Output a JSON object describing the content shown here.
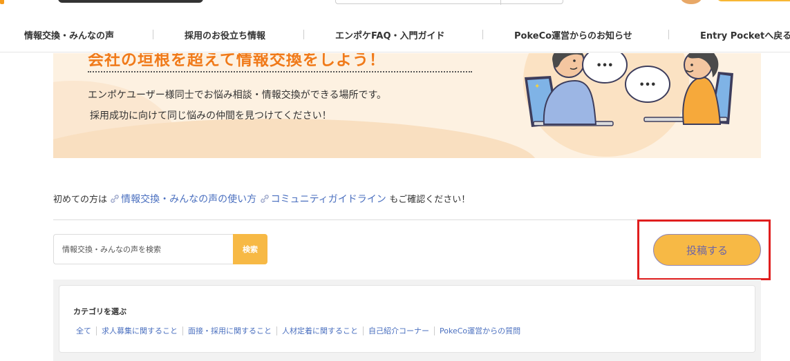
{
  "nav": {
    "items": [
      "情報交換・みんなの声",
      "採用のお役立ち情報",
      "エンポケFAQ・入門ガイド",
      "PokeCo運営からのお知らせ",
      "Entry Pocketへ戻る"
    ]
  },
  "hero": {
    "title": "会社の垣根を超えて情報交換をしよう！",
    "line1": "エンポケユーザー様同士でお悩み相談・情報交換ができる場所です。",
    "line2": "採用成功に向けて同じ悩みの仲間を見つけてください！",
    "bubble_text": "•••"
  },
  "guide": {
    "prefix": "初めての方は",
    "link1": "情報交換・みんなの声の使い方",
    "link2": "コミュニティガイドライン",
    "suffix": "もご確認ください！"
  },
  "search": {
    "placeholder": "情報交換・みんなの声を検索",
    "button_label": "検索"
  },
  "post_button": {
    "label": "投稿する"
  },
  "categories": {
    "title": "カテゴリを選ぶ",
    "items": [
      "全て",
      "求人募集に関すること",
      "面接・採用に関すること",
      "人材定着に関すること",
      "自己紹介コーナー",
      "PokeCo運営からの質問"
    ]
  },
  "colors": {
    "accent": "#f7b945",
    "brand_orange": "#f07a1a",
    "link": "#4a6fbf",
    "highlight": "#e01e1e"
  }
}
